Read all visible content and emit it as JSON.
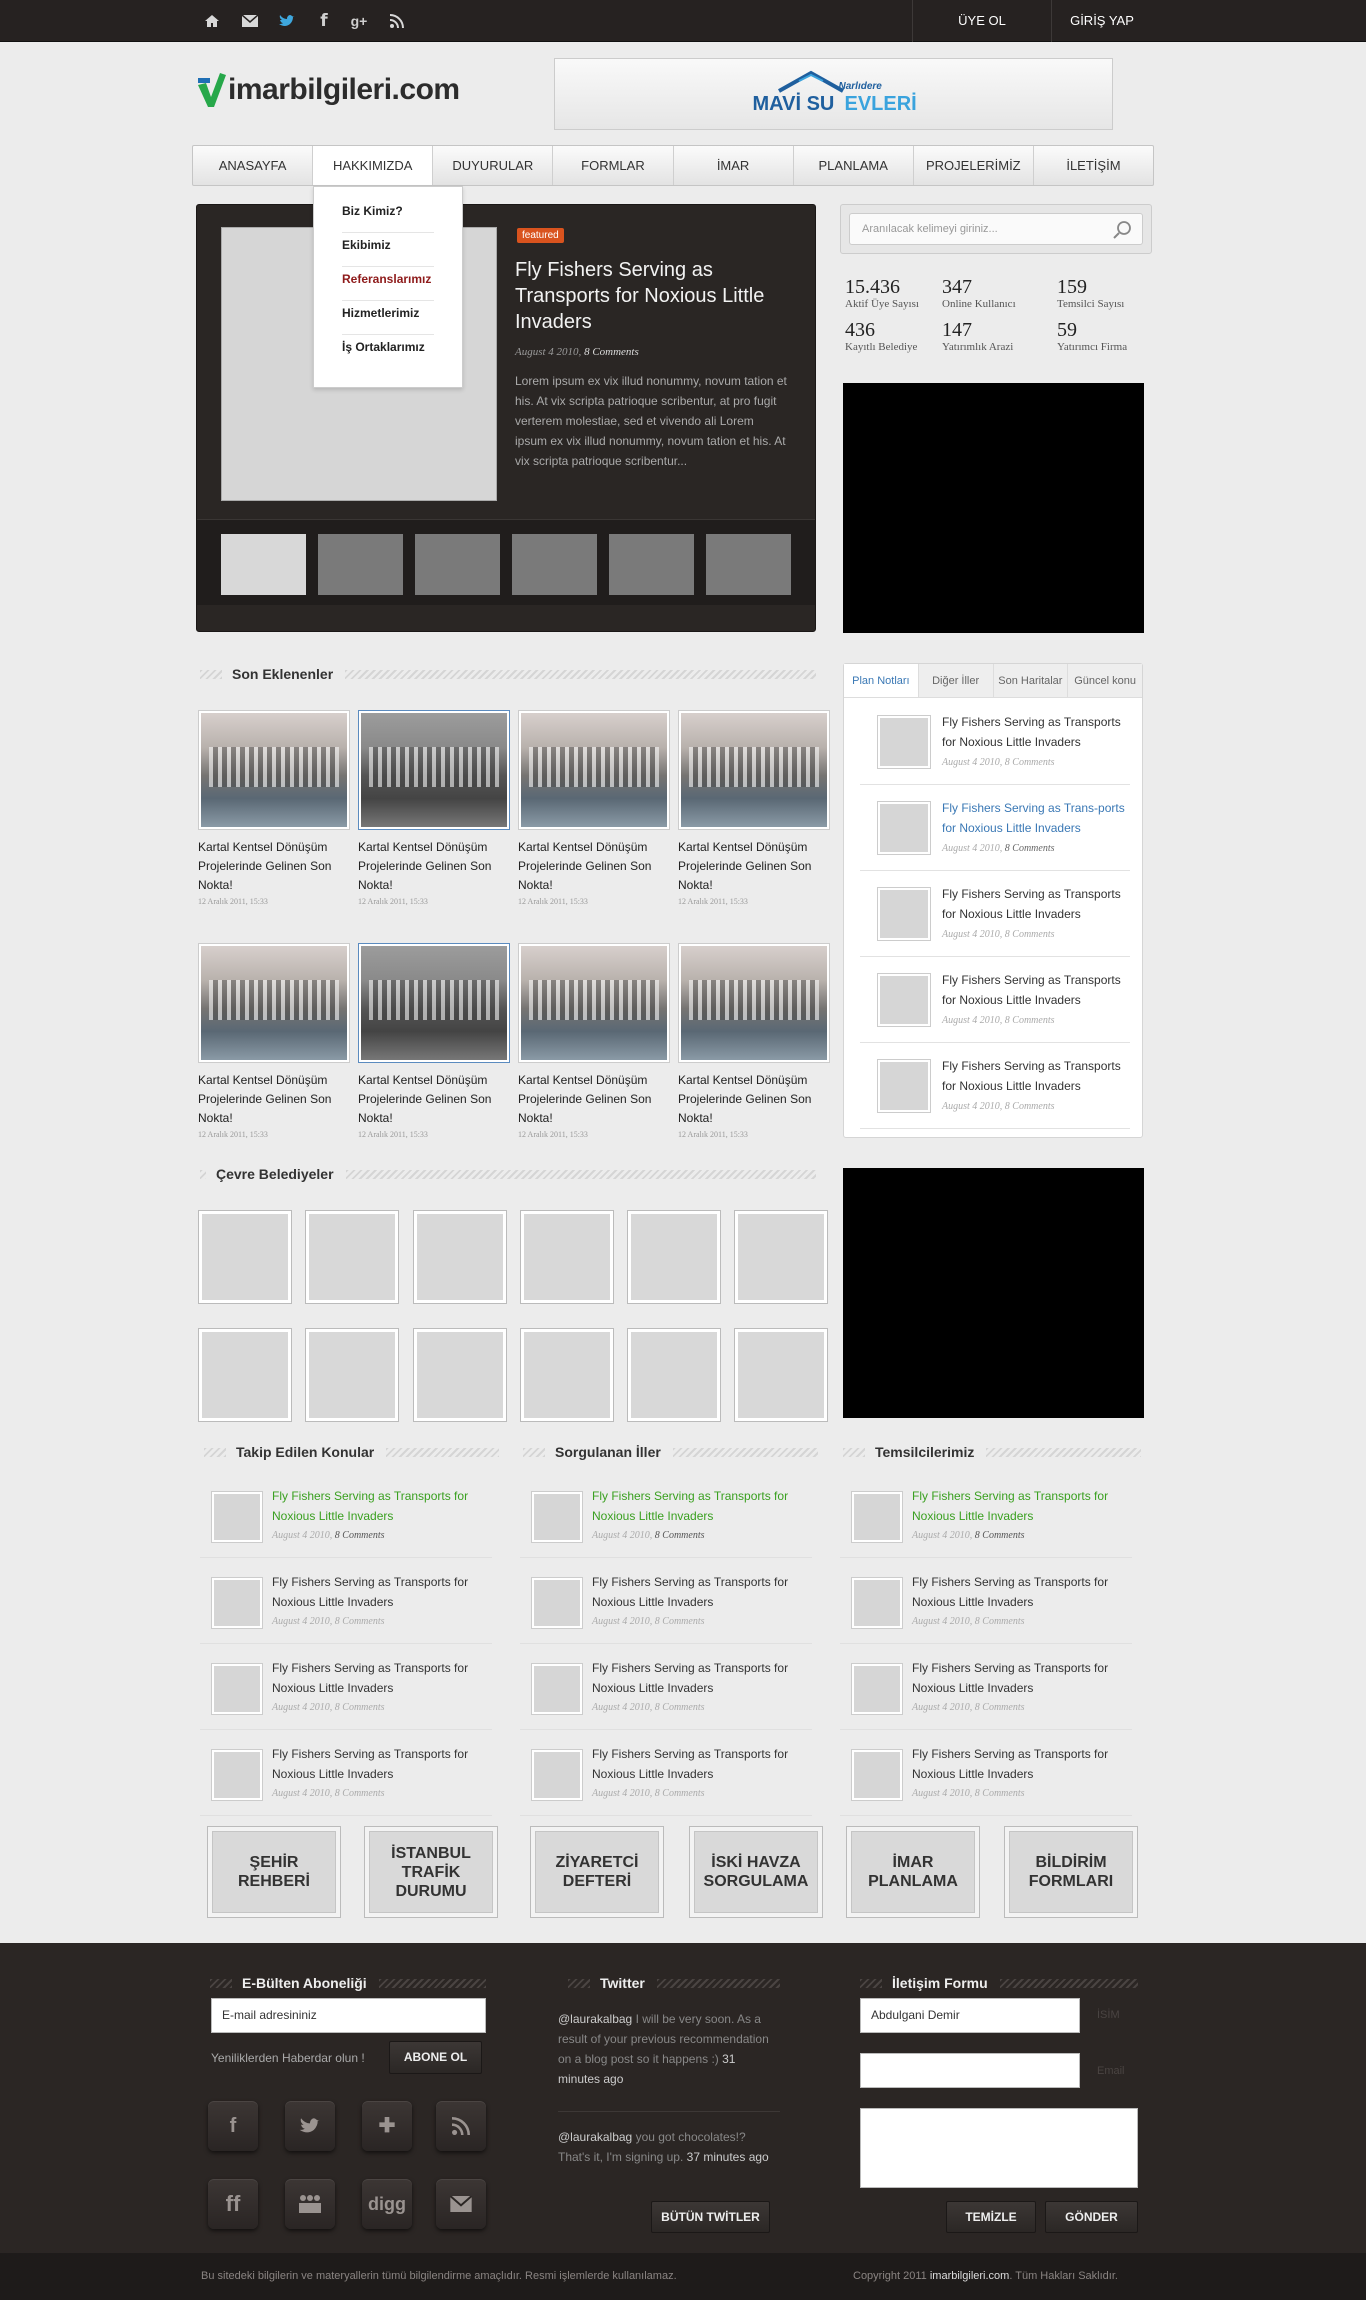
{
  "topbar": {
    "icons": [
      "home-icon",
      "mail-icon",
      "twitter-icon",
      "facebook-icon",
      "google-plus-icon",
      "rss-icon"
    ],
    "register": "ÜYE OL",
    "login": "GİRİŞ YAP"
  },
  "logo": {
    "text": "imarbilgileri.com"
  },
  "banner": {
    "small": "Narlıdere",
    "big1": "MAVİ SU",
    "big2": "EVLERİ"
  },
  "nav": [
    "ANASAYFA",
    "HAKKIMIZDA",
    "DUYURULAR",
    "FORMLAR",
    "İMAR",
    "PLANLAMA",
    "PROJELERİMİZ",
    "İLETİŞİM"
  ],
  "dropdown": [
    "Biz Kimiz?",
    "Ekibimiz",
    "Referanslarımız",
    "Hizmetlerimiz",
    "İş Ortaklarımız"
  ],
  "slider": {
    "badge": "featured",
    "title": "Fly Fishers Serving as Transports for Noxious Little Invaders",
    "date": "August 4 2010,",
    "comments": "8 Comments",
    "body": "Lorem ipsum ex vix illud nonummy, novum tation et his. At vix scripta patrioque scribentur, at pro fugit verterem molestiae, sed et vivendo ali Lorem ipsum ex vix illud nonummy, novum tation et his. At vix scripta patrioque scribentur..."
  },
  "search": {
    "placeholder": "Aranılacak kelimeyi giriniz..."
  },
  "stats": [
    {
      "n": "15.436",
      "l": "Aktif Üye Sayısı"
    },
    {
      "n": "347",
      "l": "Online Kullanıcı"
    },
    {
      "n": "159",
      "l": "Temsilci Sayısı"
    },
    {
      "n": "436",
      "l": "Kayıtlı Belediye"
    },
    {
      "n": "147",
      "l": "Yatırımlık Arazi"
    },
    {
      "n": "59",
      "l": "Yatırımcı Firma"
    }
  ],
  "son_eklenenler": {
    "title": "Son Eklenenler",
    "caption": "Kartal Kentsel Dönüşüm Projelerinde Gelinen Son Nokta!",
    "date": "12 Aralık 2011, 15:33"
  },
  "tabs": {
    "labels": [
      "Plan Notları",
      "Diğer İller",
      "Son Haritalar",
      "Güncel konu"
    ],
    "item_title": "Fly Fishers Serving as Transports for Noxious Little Invaders",
    "item_title_alt": "Fly Fishers Serving as Trans-ports for Noxious Little Invaders",
    "date": "August 4 2010,",
    "comments": "8 Comments"
  },
  "cevre": {
    "title": "Çevre Belediyeler"
  },
  "lists": {
    "takip": "Takip Edilen Konular",
    "sorgulanan": "Sorgulanan İller",
    "temsilci": "Temsilcilerimiz",
    "item_title": "Fly Fishers Serving as Transports for Noxious Little Invaders",
    "date": "August 4 2010,",
    "comments": "8 Comments"
  },
  "quick": [
    "ŞEHİR REHBERİ",
    "İSTANBUL TRAFİK DURUMU",
    "ZİYARETCİ DEFTERİ",
    "İSKİ HAVZA SORGULAMA",
    "İMAR PLANLAMA",
    "BİLDİRİM FORMLARI"
  ],
  "footer": {
    "ebulten": "E-Bülten Aboneliği",
    "email_placeholder": "E-mail adresininiz",
    "news_text": "Yeniliklerden Haberdar olun !",
    "subscribe": "ABONE OL",
    "twitter": "Twitter",
    "tweet1_user": "@laurakalbag",
    "tweet1_text": "I will be very soon. As a result of your previous recommendation on a blog post so it happens :)",
    "tweet1_time": "31 minutes ago",
    "tweet2_user": "@laurakalbag",
    "tweet2_text": "you got chocolates!? That's it, I'm signing up.",
    "tweet2_time": "37 minutes ago",
    "all_tweets": "BÜTÜN TWİTLER",
    "contact": "İletişim Formu",
    "name_value": "Abdulgani Demir",
    "name_label": "İSİM",
    "email_label": "Email",
    "clear": "TEMİZLE",
    "send": "GÖNDER",
    "social_icons": [
      "facebook-icon",
      "twitter-icon",
      "plus-icon",
      "rss-icon",
      "friendfeed-icon",
      "myspace-icon",
      "digg-icon",
      "email-icon"
    ]
  },
  "bottom": {
    "disclaimer": "Bu sitedeki bilgilerin ve materyallerin tümü bilgilendirme amaçlıdır. Resmi işlemlerde kullanılamaz.",
    "copy_pre": "Copyright 2011",
    "copy_site": "imarbilgileri.com",
    "copy_post": ". Tüm Hakları Saklıdır."
  }
}
